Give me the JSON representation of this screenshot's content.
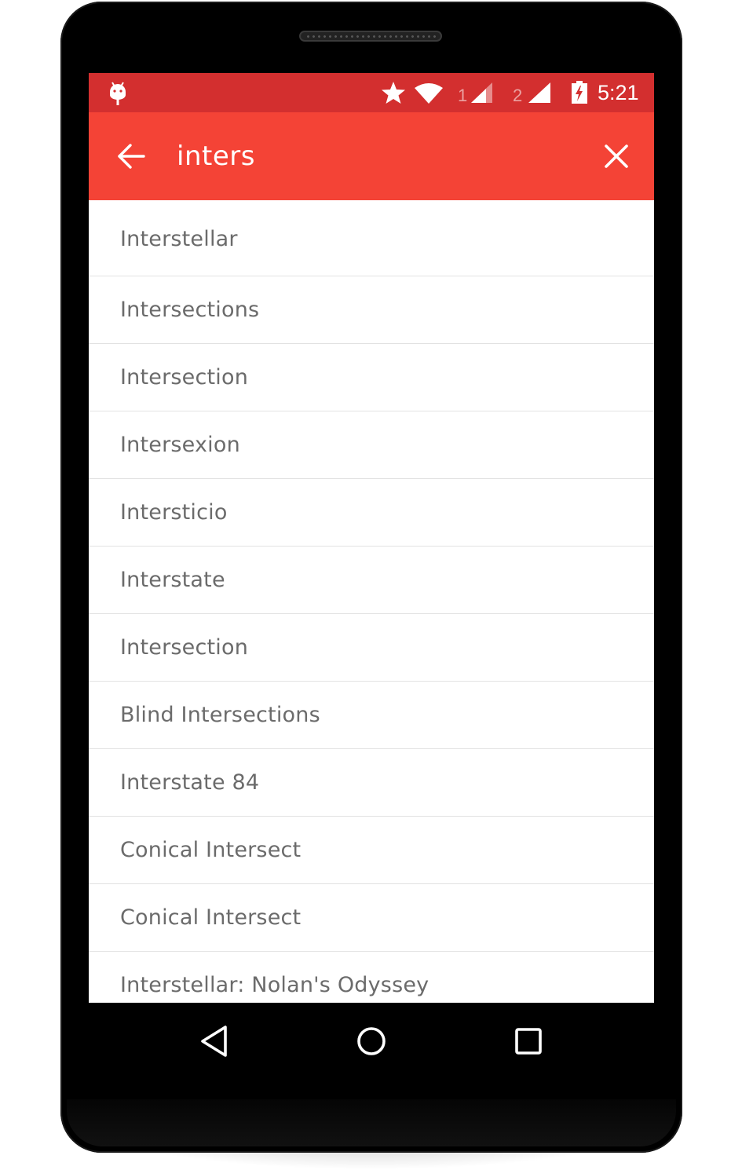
{
  "status_bar": {
    "time": "5:21",
    "sim1_label": "1",
    "sim2_label": "2",
    "icons": [
      "android-debug-icon",
      "star-icon",
      "wifi-icon",
      "signal-icon",
      "signal-icon",
      "battery-charging-icon"
    ]
  },
  "toolbar": {
    "search_value": "inters",
    "back_icon": "arrow-back-icon",
    "clear_icon": "close-icon"
  },
  "results": [
    "Interstellar",
    "Intersections",
    "Intersection",
    "Intersexion",
    "Intersticio",
    "Interstate",
    "Intersection",
    "Blind Intersections",
    "Interstate 84",
    "Conical Intersect",
    "Conical Intersect",
    "Interstellar: Nolan's Odyssey"
  ],
  "nav_bar": {
    "icons": [
      "back-triangle-icon",
      "home-circle-icon",
      "recents-square-icon"
    ]
  },
  "colors": {
    "status_bar": "#d32f2f",
    "toolbar": "#f44336",
    "list_text": "#6b6b6b",
    "divider": "#e2e2e2"
  }
}
